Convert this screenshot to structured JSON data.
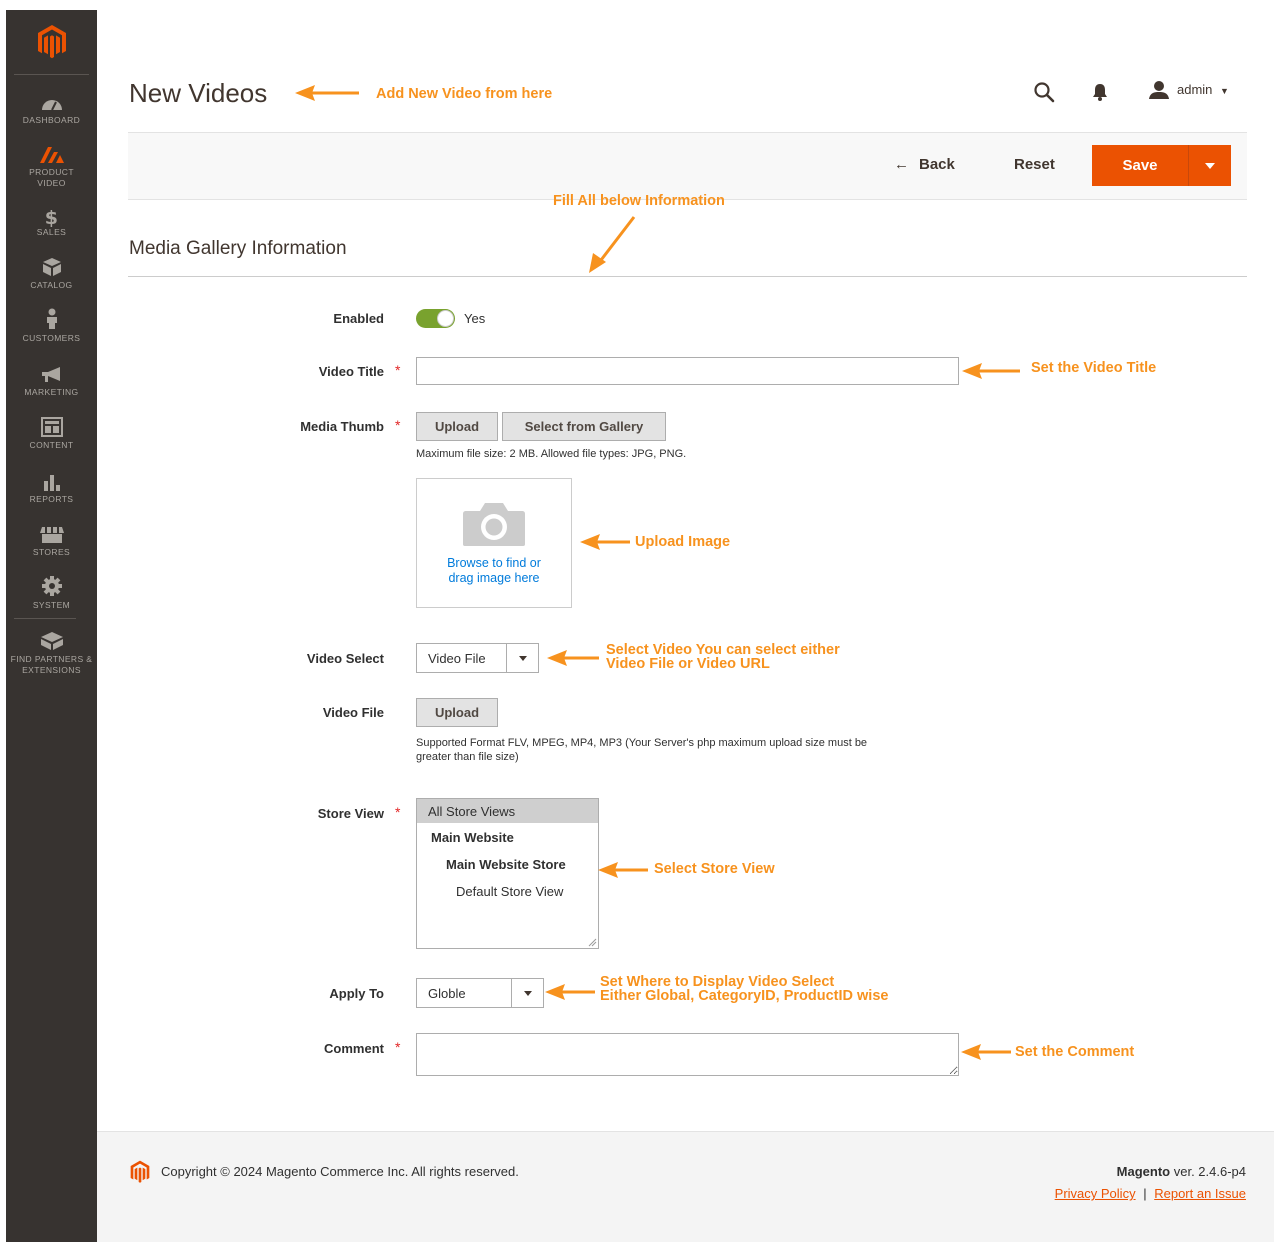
{
  "sidebar": {
    "items": [
      {
        "label": "DASHBOARD",
        "icon": "dashboard-icon"
      },
      {
        "label": "PRODUCT VIDEO",
        "icon": "product-video-icon"
      },
      {
        "label": "SALES",
        "icon": "dollar-icon"
      },
      {
        "label": "CATALOG",
        "icon": "box-icon"
      },
      {
        "label": "CUSTOMERS",
        "icon": "person-icon"
      },
      {
        "label": "MARKETING",
        "icon": "megaphone-icon"
      },
      {
        "label": "CONTENT",
        "icon": "layout-icon"
      },
      {
        "label": "REPORTS",
        "icon": "bar-chart-icon"
      },
      {
        "label": "STORES",
        "icon": "store-icon"
      },
      {
        "label": "SYSTEM",
        "icon": "gear-icon"
      },
      {
        "label": "FIND PARTNERS & EXTENSIONS",
        "icon": "cube-icon"
      }
    ]
  },
  "header": {
    "title": "New Videos",
    "user": "admin"
  },
  "actions": {
    "back": "Back",
    "reset": "Reset",
    "save": "Save"
  },
  "section": {
    "title": "Media Gallery Information"
  },
  "form": {
    "enabled_label": "Enabled",
    "enabled_value": "Yes",
    "video_title_label": "Video Title",
    "video_title_value": "",
    "media_thumb_label": "Media Thumb",
    "upload_label": "Upload",
    "gallery_label": "Select from Gallery",
    "thumb_note": "Maximum file size: 2 MB. Allowed file types: JPG, PNG.",
    "browse_line1": "Browse to find or",
    "browse_line2": "drag image here",
    "video_select_label": "Video Select",
    "video_select_value": "Video File",
    "video_file_label": "Video File",
    "video_upload_label": "Upload",
    "video_note_line1": "Supported Format FLV, MPEG, MP4, MP3 (Your Server's php maximum upload size must be",
    "video_note_line2": "greater than file size)",
    "store_view_label": "Store View",
    "store_options": [
      "All Store Views",
      "Main Website",
      "Main Website Store",
      "Default Store View"
    ],
    "apply_to_label": "Apply To",
    "apply_to_value": "Globle",
    "comment_label": "Comment",
    "comment_value": "",
    "required_mark": "*"
  },
  "annotations": {
    "add_video": "Add New Video from here",
    "fill_info": "Fill All below Information",
    "set_title": "Set the Video Title",
    "upload_image": "Upload Image",
    "select_video_1": "Select Video You can select either",
    "select_video_2": "Video File or Video URL",
    "select_store": "Select Store View",
    "apply_to_1": "Set Where to Display Video Select",
    "apply_to_2": "Either Global, CategoryID, ProductID wise",
    "set_comment": "Set the Comment"
  },
  "footer": {
    "copyright": "Copyright © 2024 Magento Commerce Inc. All rights reserved.",
    "brand": "Magento",
    "version": " ver. 2.4.6-p4",
    "privacy": "Privacy Policy",
    "separator": "|",
    "report": "Report an Issue"
  },
  "colors": {
    "accent": "#eb5202",
    "annotation": "#f7921e",
    "sidebar": "#373330",
    "toggle_on": "#79a22e",
    "link": "#007bdb"
  }
}
